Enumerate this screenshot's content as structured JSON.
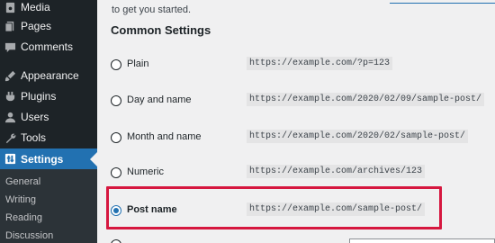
{
  "sidebar": {
    "items": [
      {
        "label": "Media",
        "icon": "media-icon"
      },
      {
        "label": "Pages",
        "icon": "pages-icon"
      },
      {
        "label": "Comments",
        "icon": "comments-icon"
      },
      {
        "label": "Appearance",
        "icon": "appearance-icon"
      },
      {
        "label": "Plugins",
        "icon": "plugins-icon"
      },
      {
        "label": "Users",
        "icon": "users-icon"
      },
      {
        "label": "Tools",
        "icon": "tools-icon"
      },
      {
        "label": "Settings",
        "icon": "settings-icon",
        "active": true
      }
    ],
    "submenu": [
      "General",
      "Writing",
      "Reading",
      "Discussion"
    ]
  },
  "main": {
    "intro_text": "to get you started.",
    "section_title": "Common Settings",
    "options": [
      {
        "label": "Plain",
        "example": "https://example.com/?p=123",
        "checked": false
      },
      {
        "label": "Day and name",
        "example": "https://example.com/2020/02/09/sample-post/",
        "checked": false
      },
      {
        "label": "Month and name",
        "example": "https://example.com/2020/02/sample-post/",
        "checked": false
      },
      {
        "label": "Numeric",
        "example": "https://example.com/archives/123",
        "checked": false
      },
      {
        "label": "Post name",
        "example": "https://example.com/sample-post/",
        "checked": true
      }
    ]
  },
  "colors": {
    "sidebar_bg": "#1d2327",
    "active_bg": "#2271b1",
    "highlight_border": "#d6173f"
  }
}
